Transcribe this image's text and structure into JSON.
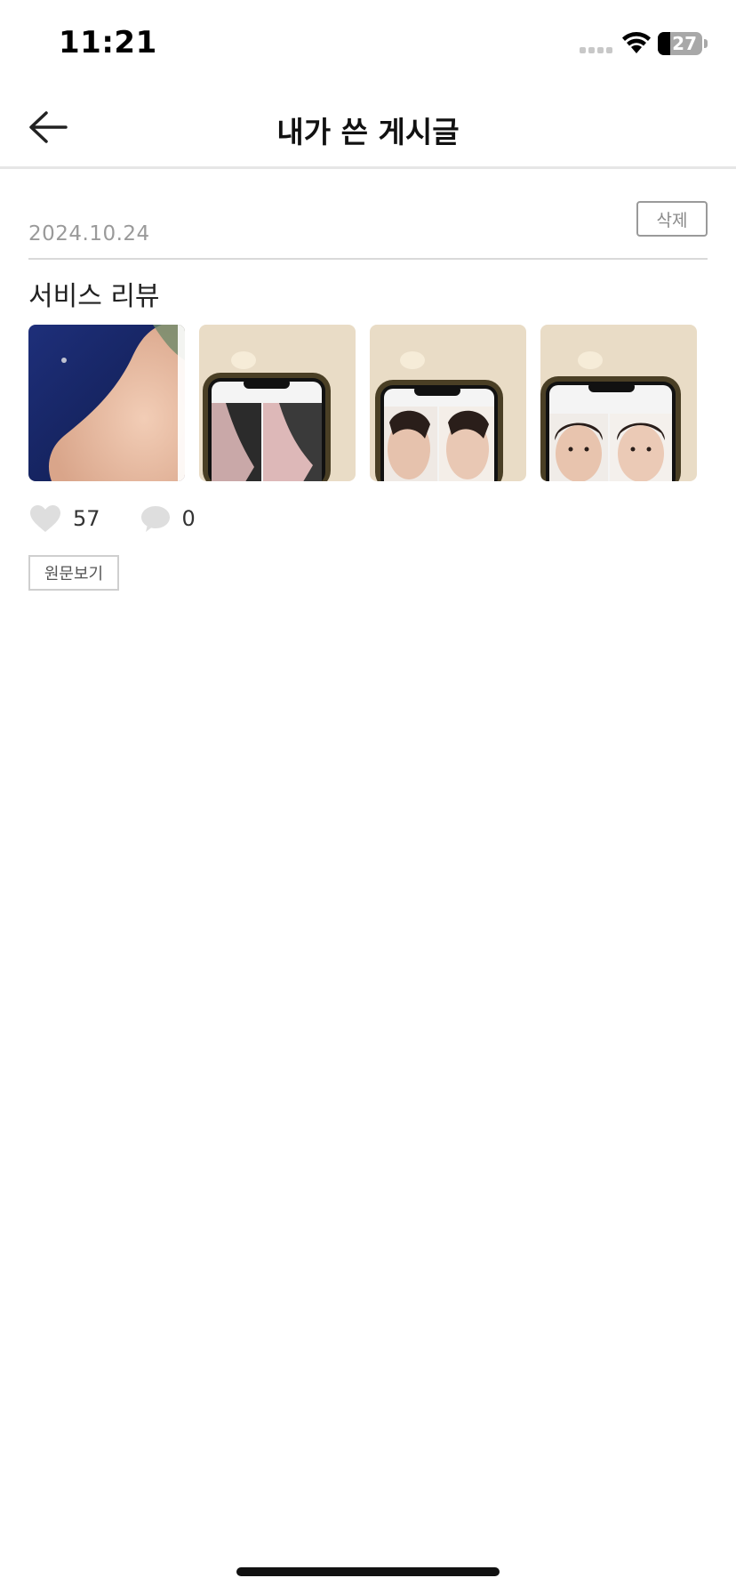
{
  "status_bar": {
    "time": "11:21",
    "battery_level": "27",
    "battery_percent": 27
  },
  "header": {
    "title": "내가 쓴 게시글",
    "back_icon": "arrow-left-icon"
  },
  "post": {
    "date": "2024.10.24",
    "delete_label": "삭제",
    "title": "서비스 리뷰",
    "images": [
      {
        "icon": "nose-closeup-photo"
      },
      {
        "icon": "phone-nose-profile-photo"
      },
      {
        "icon": "phone-face-profile-photo"
      },
      {
        "icon": "phone-face-front-photo"
      }
    ],
    "likes": "57",
    "comments": "0",
    "view_original_label": "원문보기"
  },
  "colors": {
    "divider": "#d9d9d9",
    "muted_text": "#9a9a9a",
    "icon_gray": "#dedede"
  }
}
